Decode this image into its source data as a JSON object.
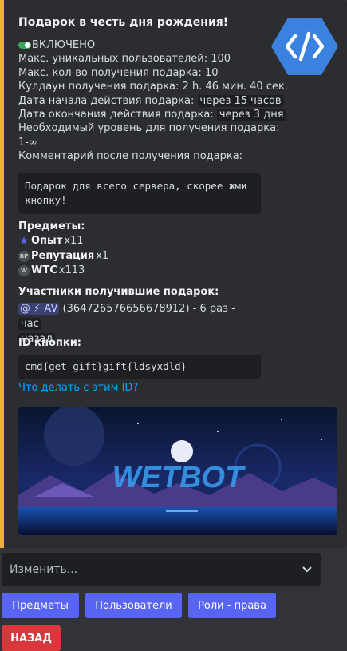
{
  "embed": {
    "title": "Подарок в честь дня рождения!",
    "status": "ВКЛЮЧЕНО",
    "lines": {
      "max_users": "Макс. уникальных пользователей: 100",
      "max_count": "Макс. кол-во получения подарка: 10",
      "cooldown": "Кулдаун получения подарка: 2 h. 46 мин. 40 сек.",
      "start_label": "Дата начала действия подарка:",
      "start_value": "через 15 часов",
      "end_label": "Дата окончания действия подарка:",
      "end_value": "через 3 дня",
      "level_label": "Необходимый уровень для получения подарка:",
      "level_value": "1-∞",
      "comment_label": "Комментарий после получения подарка:"
    },
    "comment": "Подарок для всего сервера, скорее жми кнопку!",
    "items_header": "Предметы:",
    "items": [
      {
        "icon": "star-icon",
        "name": "Опыт",
        "qty": "x11"
      },
      {
        "icon": "reputation-icon",
        "name": "Репутация",
        "qty": "x1"
      },
      {
        "icon": "wtc-coin-icon",
        "name": "WTC",
        "qty": "x113"
      }
    ],
    "participants_header": "Участники получившие подарок:",
    "participant": {
      "mention": "@ ⚡ AV",
      "id_text": "(364726576656678912) - 6 раз -",
      "time_line1": "час",
      "time_line2": "назад"
    },
    "button_id_header": "ID кнопки:",
    "button_id": "cmd{get-gift}gift{ldsyxdld}",
    "help_link": "Что делать с этим ID?",
    "banner_text": "WETBOT",
    "thumbnail_icon": "code-hexagon-icon"
  },
  "select": {
    "placeholder": "Изменить...",
    "icon": "chevron-down-icon"
  },
  "buttons": {
    "items": "Предметы",
    "users": "Пользователи",
    "roles": "Роли - права",
    "back": "НАЗАД"
  },
  "colors": {
    "accent_bar": "#f0b232",
    "primary": "#5865f2",
    "danger": "#da373c",
    "link": "#00a8fc",
    "toggle_on": "#3ba55c"
  }
}
